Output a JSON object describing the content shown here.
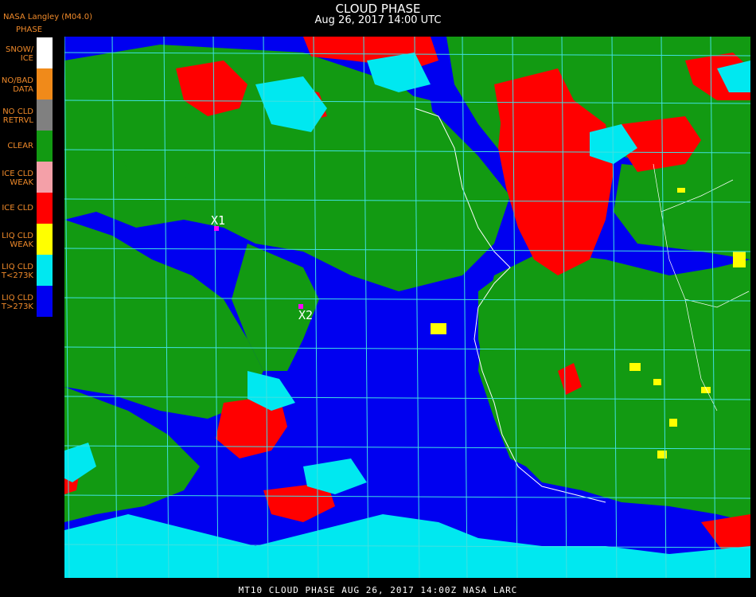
{
  "header": {
    "title": "CLOUD PHASE",
    "subtitle": "Aug 26, 2017 14:00 UTC",
    "source": "NASA Langley (M04.0)"
  },
  "legend": {
    "title": "PHASE",
    "items": [
      {
        "label": "SNOW/\nICE",
        "color": "#ffffff"
      },
      {
        "label": "NO/BAD\nDATA",
        "color": "#f08a1a"
      },
      {
        "label": "NO CLD\nRETRVL",
        "color": "#808080"
      },
      {
        "label": "CLEAR",
        "color": "#129a12"
      },
      {
        "label": "ICE CLD\nWEAK",
        "color": "#f4a0a8"
      },
      {
        "label": "ICE CLD",
        "color": "#ff0000"
      },
      {
        "label": "LIQ CLD\nWEAK",
        "color": "#ffff00"
      },
      {
        "label": "LIQ CLD\nT<273K",
        "color": "#00e8f0"
      },
      {
        "label": "LIQ CLD\nT>273K",
        "color": "#0000f0"
      }
    ]
  },
  "markers": [
    {
      "label": "X1",
      "color": "#ff00ff"
    },
    {
      "label": "X2",
      "color": "#ff00ff"
    }
  ],
  "grid": {
    "color": "#40e0e0"
  },
  "footer": "MT10  CLOUD PHASE   AUG 26, 2017 14:00Z   NASA LARC"
}
